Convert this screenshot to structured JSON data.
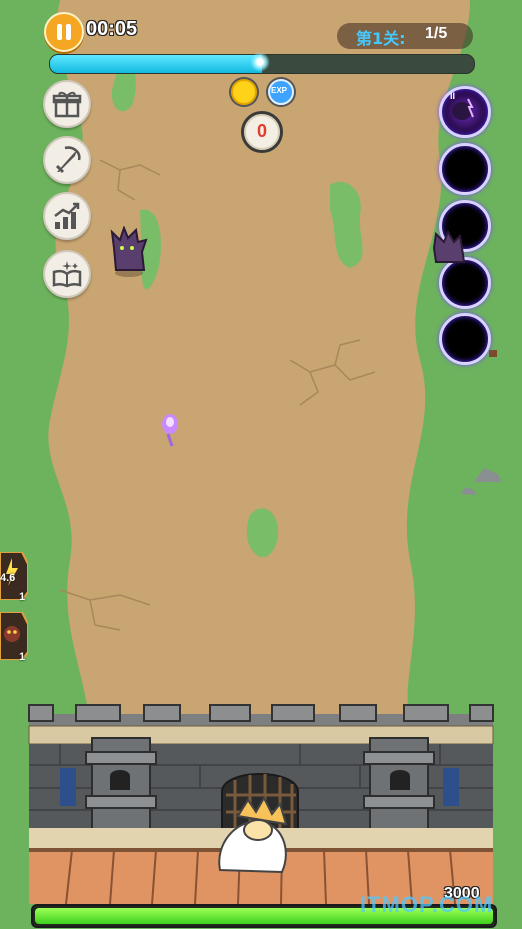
{
  "hud": {
    "timer": "00:05",
    "level_label": "第1关:",
    "level_progress": "1/5",
    "wave_progress": 0.5,
    "kill_count": "0"
  },
  "resources": {
    "coin_icon": "gold-coin-icon",
    "exp_icon": "exp-gem-icon",
    "coin_glyph": "",
    "exp_glyph": "EXP"
  },
  "side_menu": [
    {
      "name": "gift-icon"
    },
    {
      "name": "sword-skill-icon"
    },
    {
      "name": "upgrade-chart-icon"
    },
    {
      "name": "spellbook-icon"
    }
  ],
  "skill_slots": [
    {
      "state": "filled",
      "level": "II"
    },
    {
      "state": "empty"
    },
    {
      "state": "empty"
    },
    {
      "state": "empty"
    },
    {
      "state": "empty"
    }
  ],
  "buff_cards": [
    {
      "value": "4.6",
      "count": "1"
    },
    {
      "value": "",
      "count": "1"
    }
  ],
  "castle": {
    "hp": "3000",
    "hp_fraction": 1.0
  },
  "watermark": "ITMOP.COM",
  "colors": {
    "grass": "#6db35d",
    "dirt": "#c8a571",
    "wave_fill": "#2fd0f0",
    "hp_fill": "#4be024",
    "level_text": "#46c8ff"
  }
}
